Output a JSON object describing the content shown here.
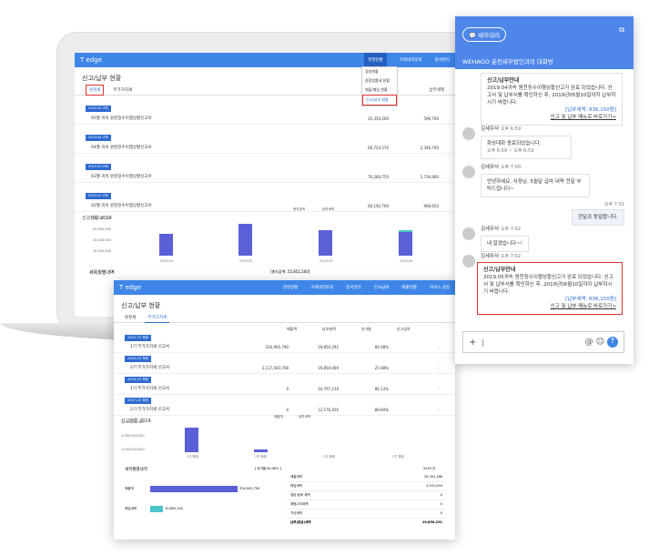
{
  "app": {
    "logo": "T edge"
  },
  "back": {
    "menu": [
      "경영현황",
      "거래내역조회",
      "증서관리"
    ],
    "title": "신고/납부 현황",
    "tabs": [
      "원천세",
      "부가가치세"
    ],
    "dropdown": [
      "경영현황",
      "종합법률세 현황",
      "매출/매입 현황",
      "신고/납부 현황"
    ],
    "rows": [
      {
        "tag": "2019.05 귀속",
        "name": "05월 귀속 원천징수이행상황신고서",
        "v1": "25,350,200",
        "v2": "596,700"
      },
      {
        "tag": "2019.04 귀속",
        "name": "04월 귀속 원천징수이행상황신고서",
        "v1": "66,724,570",
        "v2": "2,346,700"
      },
      {
        "tag": "2019.03 귀속",
        "name": "03월 귀속 원천징수이행상황신고서",
        "v1": "70,260,750",
        "v2": "1,739,890"
      },
      {
        "tag": "2019.02 귀속",
        "name": "02월 귀속 원천징수이행상황신고서",
        "v1": "60,192,700",
        "v2": "968,650"
      }
    ],
    "col_hdr": "납부세액",
    "section": "신고현황",
    "year": "2019",
    "legend": [
      "총지급액",
      "납부세액"
    ],
    "yticks": [
      "60,000,000",
      "50,000,000",
      "40,000,000",
      "30,000,000"
    ],
    "months": [
      "2019.01",
      "2019.02",
      "2019.03",
      "2019.0x"
    ],
    "bottom": "세목월별내역",
    "bottom_total": "[총지급액: 25,852,200]"
  },
  "front": {
    "menu": [
      "경영현황",
      "거래내역조회",
      "증서관리",
      "인사급여",
      "매출현황",
      "서비스 설정"
    ],
    "title": "신고/납부 현황",
    "tabs": [
      "원천세",
      "부가가치세"
    ],
    "headers": [
      "매출액",
      "납부세액",
      "부가율",
      "신고일자"
    ],
    "rows": [
      {
        "tag": "2019.1기 확정",
        "name": "1기 부가가치세 신고서",
        "c1": "334,905,790",
        "c2": "19,850,292",
        "c3": "84.08%",
        "c4": "-"
      },
      {
        "tag": "2018.2기 확정",
        "name": "2기 부가가치세 신고서",
        "c1": "2,117,043,708",
        "c2": "19,850,069",
        "c3": "25.88%",
        "c4": "-"
      },
      {
        "tag": "2018.1기 확정",
        "name": "1기 부가가치세 신고서",
        "c1": "0",
        "c2": "10,797,219",
        "c3": "86.13%",
        "c4": "-"
      },
      {
        "tag": "2017.2기 확정",
        "name": "2기 부가가치세 신고서",
        "c1": "0",
        "c2": "12,176,456",
        "c3": "88.84%",
        "c4": "-"
      }
    ],
    "section": "신고현황",
    "year": "2019",
    "legend": [
      "매출액",
      "납부세액"
    ],
    "yticks": [
      "3,000,000,000",
      "2,000,000,000",
      "1,000,000,000"
    ],
    "xcats": [
      "1기 확정",
      "2기 확정",
      "1기 확정",
      "2기 확정"
    ],
    "bottom": "세목월별내역",
    "bottom_total": "[ 부가율 84.08% ]",
    "year2": "2019 년",
    "hbars": [
      {
        "label": "매출액",
        "value": "334,905,790"
      },
      {
        "label": "매입세액",
        "value": "19,850,292"
      }
    ],
    "summary": [
      {
        "k": "매출세액",
        "v": "20,391,186"
      },
      {
        "k": "매입세액",
        "v": "3,531,094"
      },
      {
        "k": "경감·공제 세액",
        "v": "0"
      },
      {
        "k": "예정고지세액",
        "v": "0"
      },
      {
        "k": "가산세액",
        "v": "0"
      },
      {
        "k": "납부(환급)세액",
        "v": "19,850,292"
      }
    ]
  },
  "chat": {
    "pill": "세무대리",
    "title": "WEHAGO 춘천세무법인과의 대화방",
    "m1": {
      "title": "신고/납부안내",
      "body": "2019.04귀속 원천징수이행상황신고가 완료 되었습니다. 신고서 및 납부서를 확인하신 후, 2019년05월10일까지 납부하시기 바랍니다.",
      "amt": "[납부세액: 836,150원]",
      "link": "신고 및 납부 메뉴로 바로가기>"
    },
    "m2": {
      "who": "김세무사",
      "time": "오후 6:59",
      "body": "화상대화 종료되었습니다.",
      "sub": "오후 6:59 ~ 오후 6:59"
    },
    "m3": {
      "who": "김세무사",
      "time": "오후 7:00",
      "body": "안녕하세요, 사장님. 5월달 급여 내역 전달 부탁드립니다~"
    },
    "m4": {
      "time": "오후 7:01",
      "body": "전달과 동일합니다."
    },
    "m5": {
      "who": "김세무사",
      "time": "오후 7:02",
      "body": "네 알겠습니다~!"
    },
    "m6": {
      "who": "김세무사",
      "time": "오후 7:02",
      "title": "신고/납부안내",
      "body": "2019.05귀속 원천징수이행상황신고가 완료 되었습니다. 신고서 및 납부서를 확인하신 후, 2019년06월10일까지 납부하시기 바랍니다.",
      "amt": "[납부세액: 836,150원]",
      "link": "신고 및 납부 메뉴로 바로가기>"
    },
    "input_icons": [
      "+",
      "@",
      "☺",
      "↑"
    ]
  }
}
